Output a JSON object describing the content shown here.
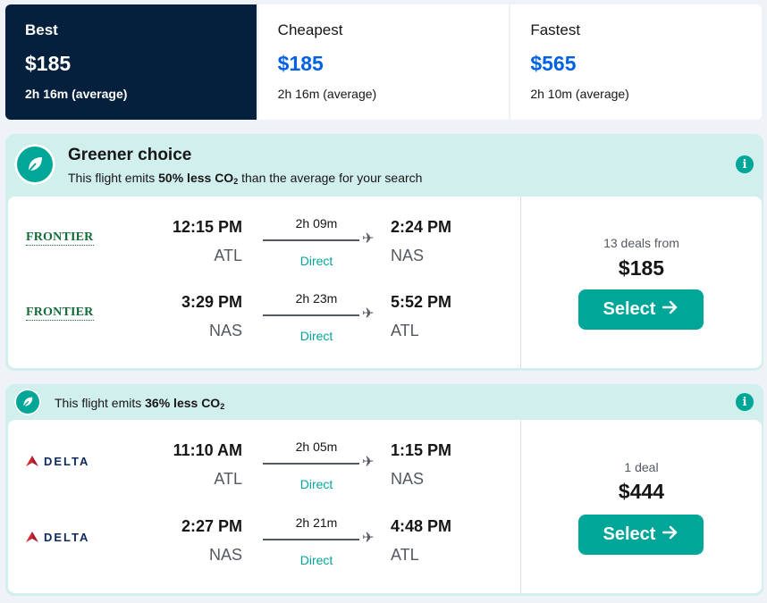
{
  "tabs": [
    {
      "label": "Best",
      "price": "$185",
      "sub": "2h 16m (average)"
    },
    {
      "label": "Cheapest",
      "price": "$185",
      "sub": "2h 16m (average)"
    },
    {
      "label": "Fastest",
      "price": "$565",
      "sub": "2h 10m (average)"
    }
  ],
  "colors": {
    "brand_dark": "#05203c",
    "accent_blue": "#0062e3",
    "eco_teal": "#00a698",
    "eco_bg": "#d1efed"
  },
  "results": [
    {
      "eco_title": "Greener choice",
      "eco_pre": "This flight emits ",
      "eco_pct": "50% less CO",
      "eco_sub": "2",
      "eco_post": " than the average for your search",
      "legs": [
        {
          "airline": "FRONTIER",
          "dep_time": "12:15 PM",
          "dep_code": "ATL",
          "duration": "2h 09m",
          "stops": "Direct",
          "arr_time": "2:24 PM",
          "arr_code": "NAS"
        },
        {
          "airline": "FRONTIER",
          "dep_time": "3:29 PM",
          "dep_code": "NAS",
          "duration": "2h 23m",
          "stops": "Direct",
          "arr_time": "5:52 PM",
          "arr_code": "ATL"
        }
      ],
      "deals": "13 deals from",
      "price": "$185",
      "select_label": "Select"
    },
    {
      "eco_pre": "This flight emits ",
      "eco_pct": "36% less CO",
      "eco_sub": "2",
      "legs": [
        {
          "airline": "DELTA",
          "dep_time": "11:10 AM",
          "dep_code": "ATL",
          "duration": "2h 05m",
          "stops": "Direct",
          "arr_time": "1:15 PM",
          "arr_code": "NAS"
        },
        {
          "airline": "DELTA",
          "dep_time": "2:27 PM",
          "dep_code": "NAS",
          "duration": "2h 21m",
          "stops": "Direct",
          "arr_time": "4:48 PM",
          "arr_code": "ATL"
        }
      ],
      "deals": "1 deal",
      "price": "$444",
      "select_label": "Select"
    }
  ],
  "icons": {
    "eco": "leaf-icon",
    "info": "info-icon",
    "plane": "plane-icon",
    "arrow": "arrow-right-icon"
  }
}
